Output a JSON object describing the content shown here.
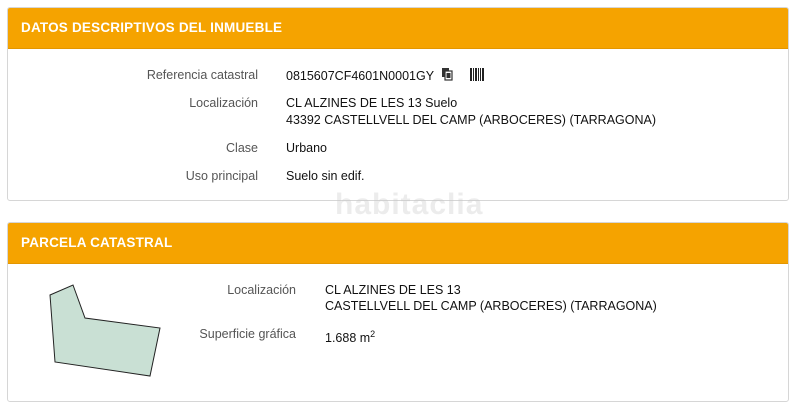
{
  "inmueble": {
    "header": "DATOS DESCRIPTIVOS DEL INMUEBLE",
    "rows": [
      {
        "label": "Referencia catastral",
        "value": "0815607CF4601N0001GY"
      },
      {
        "label": "Localización",
        "value": "CL ALZINES DE LES 13 Suelo",
        "value2": "43392 CASTELLVELL DEL CAMP (ARBOCERES) (TARRAGONA)"
      },
      {
        "label": "Clase",
        "value": "Urbano"
      },
      {
        "label": "Uso principal",
        "value": "Suelo sin edif."
      }
    ],
    "icons": [
      "copy-icon",
      "barcode-icon"
    ]
  },
  "watermark": "habitaclia",
  "parcela": {
    "header": "PARCELA CATASTRAL",
    "localizacion_label": "Localización",
    "localizacion_line1": "CL ALZINES DE LES 13",
    "localizacion_line2": "CASTELLVELL DEL CAMP (ARBOCERES) (TARRAGONA)",
    "superficie_label": "Superficie gráfica",
    "superficie_value": "1.688 m",
    "superficie_unit_exp": "2",
    "map_fill": "#c9e0d4"
  },
  "colors": {
    "header": "#f5a300"
  }
}
